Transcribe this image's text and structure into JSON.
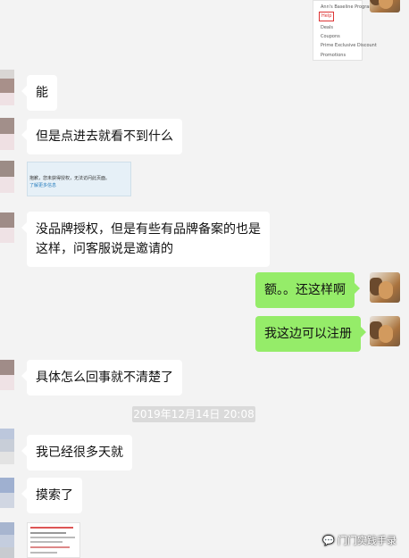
{
  "messages": {
    "m1": "能",
    "m2": "但是点进去就看不到什么",
    "m3": "没品牌授权，但是有些有品牌备案的也是",
    "m3b": "这样，问客服说是邀请的",
    "m4": "额。。还这样啊",
    "m5": "我这边可以注册",
    "m6": "具体怎么回事就不清楚了",
    "m7": "我已经很多天就",
    "m8": "摸索了"
  },
  "timestamp": "2019年12月14日 20:08",
  "image_top": {
    "line1": "Ann's Baseline Program",
    "line2": "Help",
    "line3": "Deals",
    "line4": "Coupons",
    "line5": "Prime Exclusive Discount",
    "line6": "Promotions"
  },
  "image_mid": {
    "line1": "抱歉，您未获得授权，无法访问此页面。",
    "line2": "了解更多信息"
  },
  "watermark": "门门实践手录",
  "colors": {
    "background": "#f3f3f3",
    "self_bubble": "#95ec69",
    "other_bubble": "#ffffff"
  }
}
